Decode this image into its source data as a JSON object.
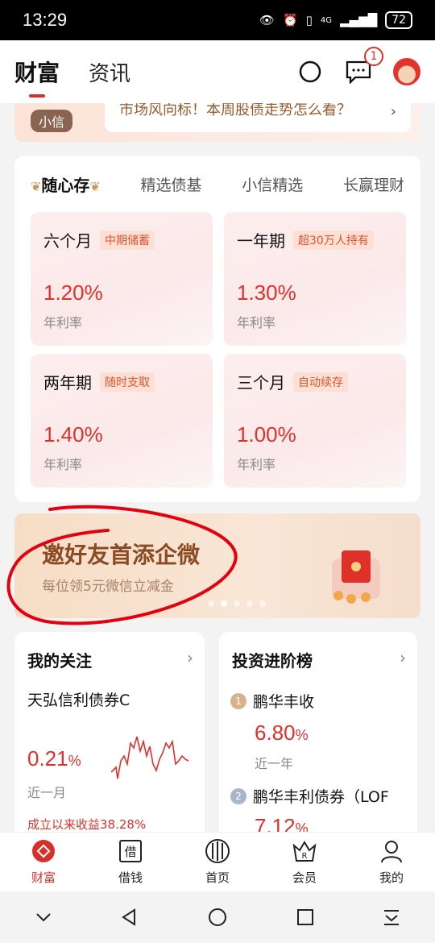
{
  "status_bar": {
    "time": "13:29",
    "battery": "72",
    "network": "4G"
  },
  "header": {
    "tabs": [
      "财富",
      "资讯"
    ],
    "message_badge": "1"
  },
  "notice": {
    "tag": "小信",
    "text": "市场风向标！本周股债走势怎么看？"
  },
  "savings_card": {
    "categories": [
      "随心存",
      "精选债基",
      "小信精选",
      "长赢理财"
    ],
    "products": [
      {
        "name": "六个月",
        "tag": "中期储蓄",
        "rate": "1.20%",
        "rate_label": "年利率"
      },
      {
        "name": "一年期",
        "tag": "超30万人持有",
        "rate": "1.30%",
        "rate_label": "年利率"
      },
      {
        "name": "两年期",
        "tag": "随时支取",
        "rate": "1.40%",
        "rate_label": "年利率"
      },
      {
        "name": "三个月",
        "tag": "自动续存",
        "rate": "1.00%",
        "rate_label": "年利率"
      }
    ]
  },
  "banner": {
    "title": "邀好友首添企微",
    "subtitle": "每位领5元微信立减金"
  },
  "follow": {
    "title": "我的关注",
    "fund_name": "天弘信利债券C",
    "rate_value": "0.21",
    "rate_unit": "%",
    "rate_label": "近一月",
    "total": "成立以来收益38.28%"
  },
  "ranking": {
    "title": "投资进阶榜",
    "items": [
      {
        "rank": "1",
        "name": "鹏华丰收",
        "rate_value": "6.80",
        "rate_unit": "%",
        "rate_label": "近一年"
      },
      {
        "rank": "2",
        "name": "鹏华丰利债券（LOF",
        "rate_value": "7.12",
        "rate_unit": "%"
      }
    ]
  },
  "bottom_nav": [
    "财富",
    "借钱",
    "首页",
    "会员",
    "我的"
  ],
  "colors": {
    "accent": "#d6302c",
    "rate": "#e0302a"
  }
}
